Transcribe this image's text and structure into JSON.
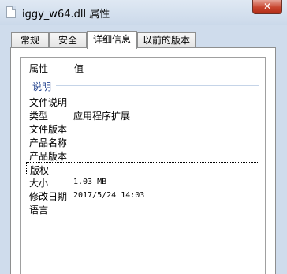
{
  "window": {
    "title": "iggy_w64.dll 属性",
    "close_label": "✕"
  },
  "tabs": [
    {
      "label": "常规"
    },
    {
      "label": "安全"
    },
    {
      "label": "详细信息"
    },
    {
      "label": "以前的版本"
    }
  ],
  "list": {
    "columns": [
      "属性",
      "值"
    ],
    "group": "说明",
    "rows": [
      {
        "name": "文件说明",
        "value": ""
      },
      {
        "name": "类型",
        "value": "应用程序扩展"
      },
      {
        "name": "文件版本",
        "value": ""
      },
      {
        "name": "产品名称",
        "value": ""
      },
      {
        "name": "产品版本",
        "value": ""
      },
      {
        "name": "版权",
        "value": ""
      },
      {
        "name": "大小",
        "value": "1.03 MB"
      },
      {
        "name": "修改日期",
        "value": "2017/5/24 14:03"
      },
      {
        "name": "语言",
        "value": ""
      }
    ]
  }
}
